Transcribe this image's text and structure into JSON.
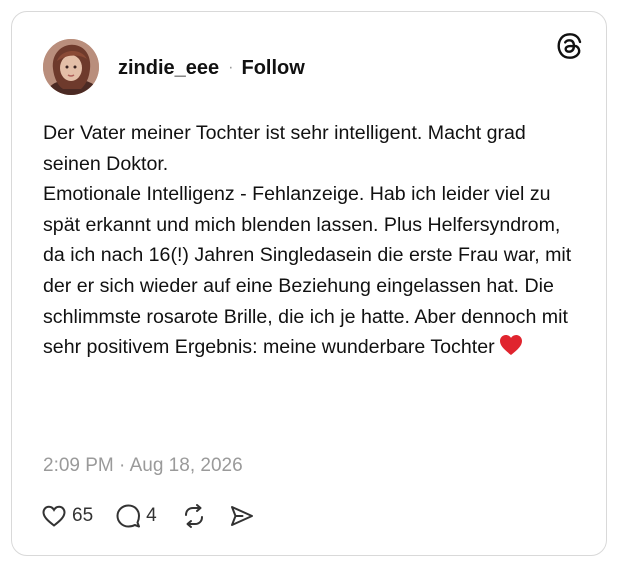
{
  "post": {
    "username": "zindie_eee",
    "separator": "·",
    "follow_label": "Follow",
    "body": "Der Vater meiner Tochter ist sehr intelligent. Macht grad seinen Doktor.\nEmotionale Intelligenz - Fehlanzeige. Hab ich leider viel zu spät erkannt und mich blenden lassen. Plus Helfersyndrom, da ich nach 16(!) Jahren Singledasein die erste Frau war, mit der er sich wieder auf eine Beziehung eingelassen hat. Die schlimmste rosarote Brille, die ich je hatte. Aber dennoch mit sehr positivem Ergebnis: meine wunderbare Tochter",
    "timestamp": "2:09 PM · Aug 18, 2026"
  },
  "actions": {
    "likes": "65",
    "replies": "4"
  },
  "icons": {
    "logo": "threads-logo-icon",
    "like": "heart-outline-icon",
    "reply": "speech-bubble-icon",
    "repost": "repost-icon",
    "share": "send-icon",
    "emoji": "red-heart-emoji"
  },
  "colors": {
    "text": "#111111",
    "muted": "#9a9a9a",
    "border": "#d9d9d9",
    "heart": "#e0242e"
  }
}
